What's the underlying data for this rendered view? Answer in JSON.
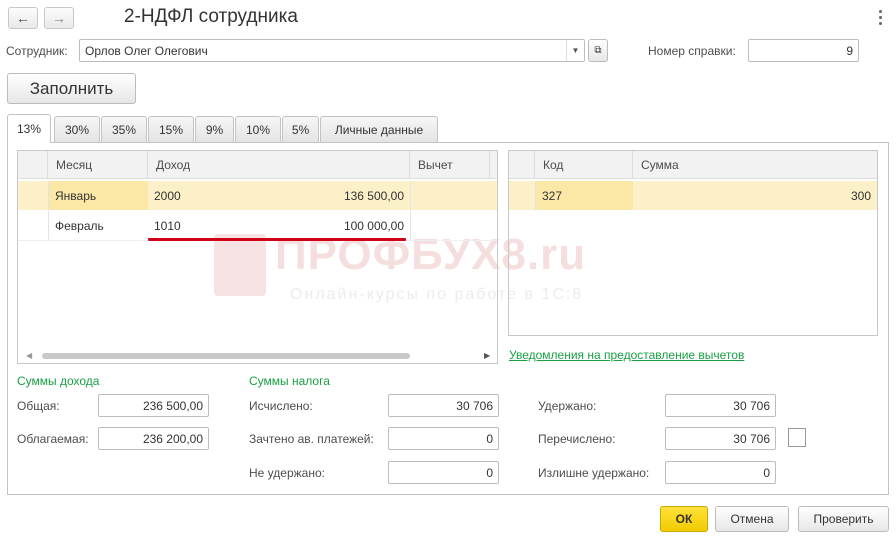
{
  "window": {
    "title": "2-НДФЛ сотрудника",
    "back_icon": "arrow-left-icon",
    "forward_icon": "arrow-right-icon",
    "more_icon": "vertical-dots-icon"
  },
  "employee": {
    "label": "Сотрудник:",
    "value": "Орлов Олег Олегович"
  },
  "certificate_number": {
    "label": "Номер справки:",
    "value": "9"
  },
  "fill_button": "Заполнить",
  "tabs": [
    "13%",
    "30%",
    "35%",
    "15%",
    "9%",
    "10%",
    "5%",
    "Личные данные"
  ],
  "income_table": {
    "headers": [
      "Месяц",
      "Доход",
      "Вычет"
    ],
    "rows": [
      {
        "month": "Январь",
        "code": "2000",
        "amount": "136 500,00"
      },
      {
        "month": "Февраль",
        "code": "1010",
        "amount": "100 000,00"
      }
    ]
  },
  "deduction_table": {
    "headers": [
      "Код",
      "Сумма"
    ],
    "rows": [
      {
        "code": "327",
        "sum": "300"
      }
    ]
  },
  "notifications_link": "Уведомления на предоставление вычетов",
  "income_totals": {
    "title": "Суммы дохода",
    "total_label": "Общая:",
    "total_value": "236 500,00",
    "taxable_label": "Облагаемая:",
    "taxable_value": "236 200,00"
  },
  "tax_totals": {
    "title": "Суммы налога",
    "calculated_label": "Исчислено:",
    "calculated_value": "30 706",
    "advance_label": "Зачтено ав. платежей:",
    "advance_value": "0",
    "not_withheld_label": "Не удержано:",
    "not_withheld_value": "0",
    "withheld_label": "Удержано:",
    "withheld_value": "30 706",
    "transferred_label": "Перечислено:",
    "transferred_value": "30 706",
    "excess_label": "Излишне удержано:",
    "excess_value": "0"
  },
  "watermark": {
    "brand": "ПРОФБУХ8.ru",
    "tagline": "Онлайн-курсы по работе в 1С:8"
  },
  "footer": {
    "ok": "ОК",
    "cancel": "Отмена",
    "check": "Проверить"
  },
  "colors": {
    "selected_row": "#fbf0c8",
    "link_green": "#19a044",
    "ok_button": "#f7d300",
    "underline_red": "#d0021b"
  }
}
